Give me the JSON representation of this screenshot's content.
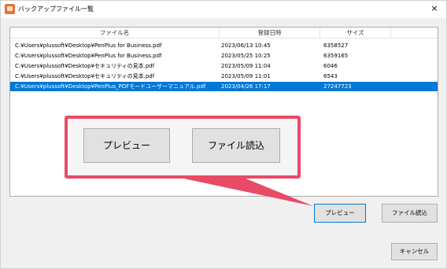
{
  "window": {
    "title": "バックアップファイル一覧",
    "close_glyph": "×"
  },
  "list": {
    "columns": [
      "ファイル名",
      "登録日時",
      "サイズ"
    ],
    "rows": [
      {
        "name": "C:¥Users¥plussoft¥Desktop¥PenPlus for Business.pdf",
        "date": "2023/06/13 10:45",
        "size": "6358527",
        "selected": false
      },
      {
        "name": "C:¥Users¥plussoft¥Desktop¥PenPlus for Business.pdf",
        "date": "2023/05/25 10:25",
        "size": "6359165",
        "selected": false
      },
      {
        "name": "C:¥Users¥plussoft¥Desktop¥セキュリティの見本.pdf",
        "date": "2023/05/09 11:04",
        "size": "6046",
        "selected": false
      },
      {
        "name": "C:¥Users¥plussoft¥Desktop¥セキュリティの見本.pdf",
        "date": "2023/05/09 11:01",
        "size": "6543",
        "selected": false
      },
      {
        "name": "C:¥Users¥plussoft¥Desktop¥PenPlus_PDFモードユーザーマニュアル.pdf",
        "date": "2023/04/26 17:17",
        "size": "27247723",
        "selected": true
      }
    ]
  },
  "callout": {
    "preview_label": "プレビュー",
    "load_label": "ファイル読込",
    "accent_color": "#e94a66"
  },
  "buttons": {
    "preview": "プレビュー",
    "load": "ファイル読込",
    "cancel": "キャンセル"
  },
  "colors": {
    "selection": "#0078d7"
  }
}
